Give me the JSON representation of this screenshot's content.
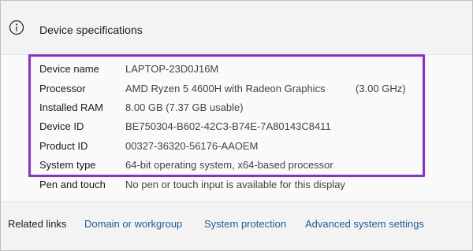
{
  "header": {
    "icon": "info-icon",
    "title": "Device specifications"
  },
  "specs": [
    {
      "label": "Device name",
      "value": "LAPTOP-23D0J16M",
      "extra": ""
    },
    {
      "label": "Processor",
      "value": "AMD Ryzen 5 4600H with Radeon Graphics",
      "extra": "(3.00 GHz)"
    },
    {
      "label": "Installed RAM",
      "value": "8.00 GB (7.37 GB usable)",
      "extra": ""
    },
    {
      "label": "Device ID",
      "value": "BE750304-B602-42C3-B74E-7A80143C8411",
      "extra": ""
    },
    {
      "label": "Product ID",
      "value": "00327-36320-56176-AAOEM",
      "extra": ""
    },
    {
      "label": "System type",
      "value": "64-bit operating system, x64-based processor",
      "extra": ""
    },
    {
      "label": "Pen and touch",
      "value": "No pen or touch input is available for this display",
      "extra": ""
    }
  ],
  "related": {
    "title": "Related links",
    "links": [
      "Domain or workgroup",
      "System protection",
      "Advanced system settings"
    ]
  },
  "colors": {
    "highlight": "#8a2ed6",
    "link": "#1f5a9b"
  }
}
